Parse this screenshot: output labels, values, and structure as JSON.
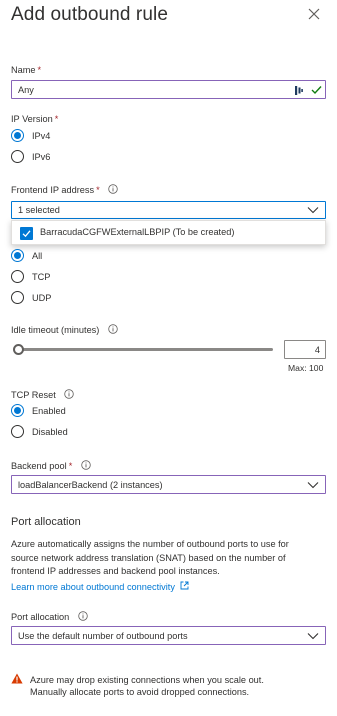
{
  "panel": {
    "title": "Add outbound rule"
  },
  "name_field": {
    "label": "Name",
    "value": "Any"
  },
  "ip_version": {
    "label": "IP Version",
    "options": [
      "IPv4",
      "IPv6"
    ],
    "selected": "IPv4"
  },
  "frontend_ip": {
    "label": "Frontend IP address",
    "value": "1 selected",
    "dropdown_options": [
      "BarracudaCGFWExternalLBPIP (To be created)"
    ]
  },
  "protocol": {
    "options": [
      "All",
      "TCP",
      "UDP"
    ],
    "selected": "All"
  },
  "idle_timeout": {
    "label": "Idle timeout (minutes)",
    "value": "4",
    "max_label": "Max: 100"
  },
  "tcp_reset": {
    "label": "TCP Reset",
    "options": [
      "Enabled",
      "Disabled"
    ],
    "selected": "Enabled"
  },
  "backend_pool": {
    "label": "Backend pool",
    "value": "loadBalancerBackend (2 instances)"
  },
  "port_allocation_section": {
    "title": "Port allocation",
    "description": "Azure automatically assigns the number of outbound ports to use for source network address translation (SNAT) based on the number of frontend IP addresses and backend pool instances.",
    "desc_lines": [
      "Azure automatically assigns the number of outbound ports to use for",
      "source network address translation (SNAT) based on the number of",
      "frontend IP addresses and backend pool instances."
    ],
    "link": "Learn more about outbound connectivity"
  },
  "port_allocation": {
    "label": "Port allocation",
    "value": "Use the default number of outbound ports"
  },
  "warning": {
    "lines": [
      "Azure may drop existing connections when you scale out.",
      "Manually allocate ports to avoid dropped connections."
    ]
  },
  "colors": {
    "accent": "#0078d4",
    "required": "#a4262c",
    "field_focus": "#8764b8",
    "warning": "#d83b01"
  }
}
